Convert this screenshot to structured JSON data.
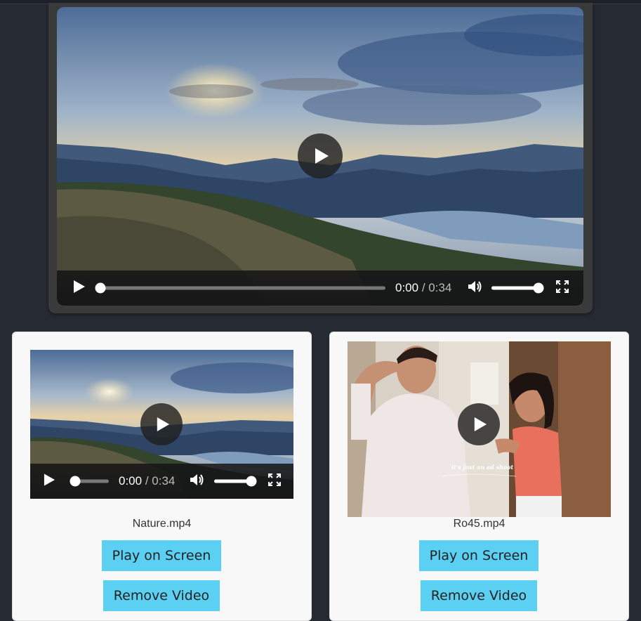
{
  "main_player": {
    "current_time": "0:00",
    "separator": " / ",
    "duration": "0:34",
    "progress": 0,
    "volume": 0.95
  },
  "videos": [
    {
      "filename": "Nature.mp4",
      "current_time": "0:00",
      "separator": " / ",
      "duration": "0:34",
      "progress": 0,
      "volume": 0.95,
      "play_label": "Play on Screen",
      "remove_label": "Remove Video"
    },
    {
      "filename": "Ro45.mp4",
      "play_label": "Play on Screen",
      "remove_label": "Remove Video",
      "overlay_caption": "it's just an ad shoot"
    }
  ],
  "icons": {
    "play": "play-icon",
    "volume": "volume-icon",
    "fullscreen": "fullscreen-icon"
  },
  "colors": {
    "page_bg": "#262a33",
    "button_bg": "#5bd0f2",
    "card_bg": "#f8f8f8"
  }
}
